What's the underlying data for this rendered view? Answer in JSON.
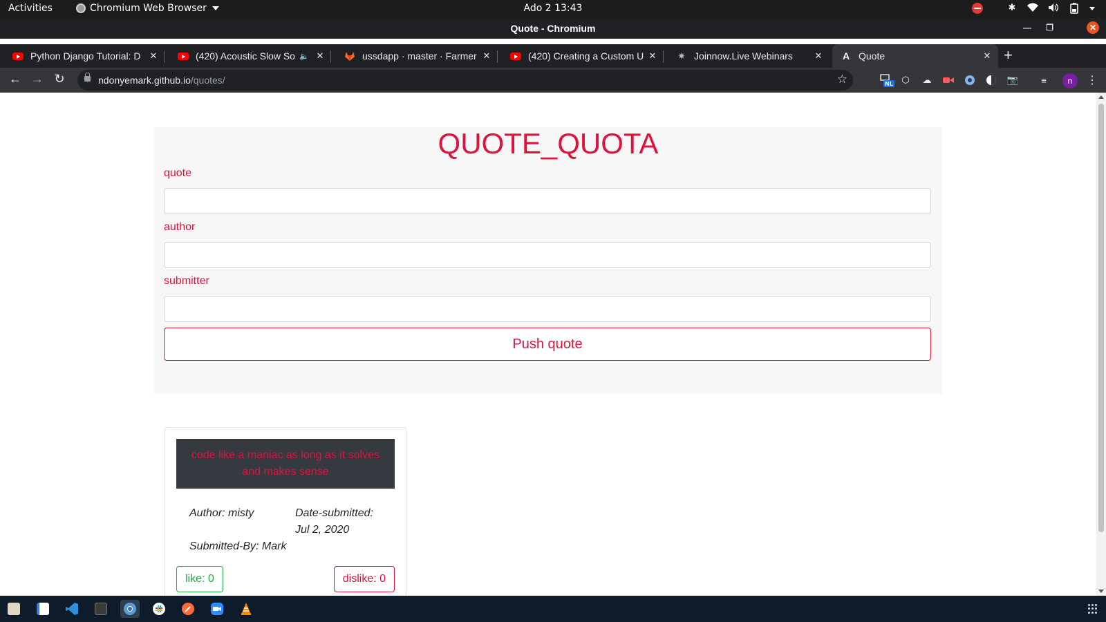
{
  "topbar": {
    "activities": "Activities",
    "app_name": "Chromium Web Browser",
    "clock": "Ado 2  13:43"
  },
  "window": {
    "title": "Quote - Chromium"
  },
  "tabs": [
    {
      "label": "Python Django Tutorial: D",
      "favicon": "youtube-icon"
    },
    {
      "label": "(420) Acoustic Slow So",
      "favicon": "youtube-icon"
    },
    {
      "label": "ussdapp · master · Farmer",
      "favicon": "gitlab-icon"
    },
    {
      "label": "(420) Creating a Custom U",
      "favicon": "youtube-icon"
    },
    {
      "label": "Joinnow.Live Webinars",
      "favicon": "joinnow-icon"
    },
    {
      "label": "Quote",
      "favicon": "angular-icon",
      "active": true
    }
  ],
  "address": {
    "host": "ndonyemark.github.io",
    "path": "/quotes/"
  },
  "profile": {
    "initial": "n"
  },
  "extensions": {
    "nl_badge": "NL"
  },
  "page": {
    "heading": "QUOTE_QUOTA",
    "form": {
      "quote_label": "quote",
      "author_label": "author",
      "submitter_label": "submitter",
      "quote_value": "",
      "author_value": "",
      "submitter_value": "",
      "submit_label": "Push quote"
    },
    "quotes": [
      {
        "text": "code like a maniac as long as it solves and makes sense",
        "author": "Author: misty",
        "date_label": "Date-submitted:",
        "date": "Jul 2, 2020",
        "submitter": "Submitted-By: Mark",
        "like": "like: 0",
        "dislike": "dislike: 0"
      }
    ]
  },
  "colors": {
    "accent": "#dc143c",
    "like": "#28a745",
    "quote_bg": "#343a40"
  }
}
